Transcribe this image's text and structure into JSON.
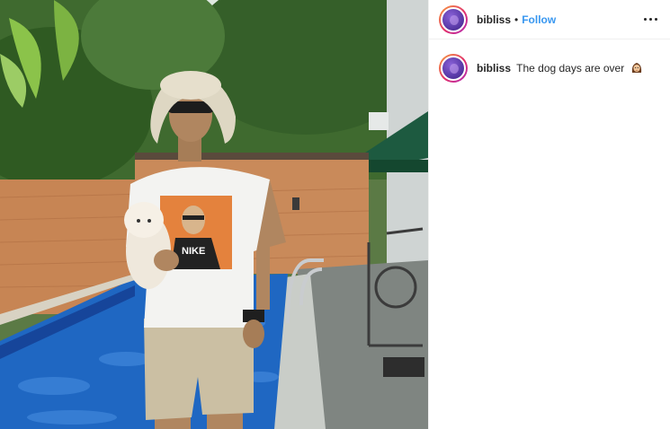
{
  "post": {
    "username": "bibliss",
    "separator": "•",
    "follow_label": "Follow",
    "more_icon": "more-options-icon"
  },
  "caption": {
    "username": "bibliss",
    "text": "The dog days are over",
    "emoji": "woman-raising-hand-emoji"
  },
  "photo": {
    "tshirt_print_text": "NIKE"
  }
}
